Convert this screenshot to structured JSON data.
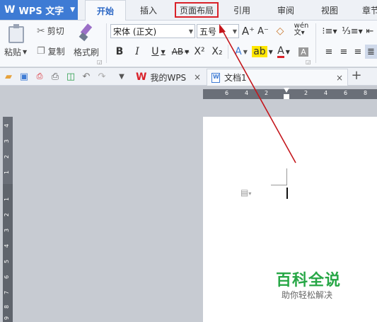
{
  "app": {
    "name": "WPS 文字"
  },
  "tabs": [
    "开始",
    "插入",
    "页面布局",
    "引用",
    "审阅",
    "视图",
    "章节"
  ],
  "ribbon": {
    "paste": "粘贴",
    "cut": "剪切",
    "copy": "复制",
    "format_painter": "格式刷",
    "font_name": "宋体 (正文)",
    "font_size": "五号",
    "bold": "B",
    "italic": "I",
    "underline": "U",
    "strikethrough": "AB",
    "superscript": "X²",
    "subscript": "X₂"
  },
  "doc_tabs": {
    "my_wps": "我的WPS",
    "document": "文档1",
    "new_tab": "+"
  },
  "ruler_top": [
    "6",
    "4",
    "2",
    "2",
    "4",
    "6",
    "8"
  ],
  "ruler_left": [
    "4",
    "3",
    "2",
    "1",
    "1",
    "2",
    "3",
    "4",
    "5",
    "6",
    "7",
    "8",
    "9"
  ],
  "watermark": {
    "title": "百科全说",
    "subtitle": "助你轻松解决"
  },
  "colors": {
    "accent": "#3e7bd4",
    "highlight_box": "#d9222a",
    "watermark": "#27a746"
  }
}
